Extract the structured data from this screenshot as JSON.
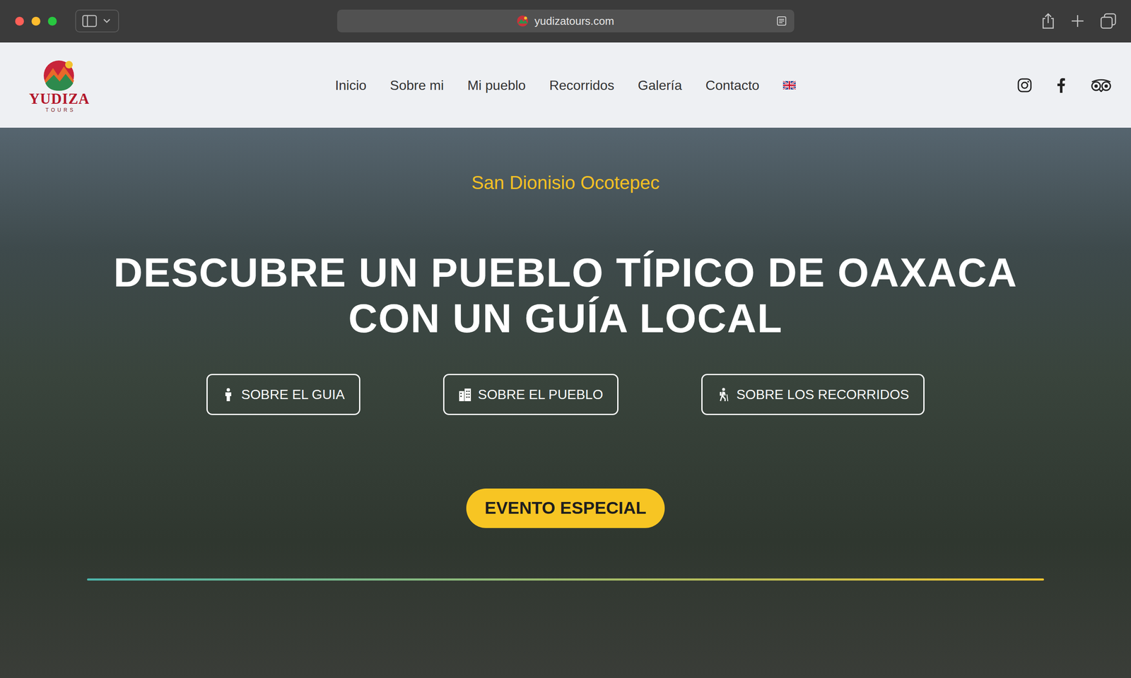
{
  "browser": {
    "url": "yudizatours.com"
  },
  "logo": {
    "name": "YUDIZA",
    "tagline": "TOURS"
  },
  "nav": {
    "links": [
      {
        "label": "Inicio",
        "selected": false
      },
      {
        "label": "Sobre mi",
        "selected": false
      },
      {
        "label": "Mi pueblo",
        "selected": false
      },
      {
        "label": "Recorridos",
        "selected": false
      },
      {
        "label": "Galería",
        "selected": false
      },
      {
        "label": "Contacto",
        "selected": false
      }
    ]
  },
  "hero": {
    "kicker": "San Dionisio Ocotepec",
    "heading_lines": [
      "DESCUBRE UN PUEBLO TÍPICO DE OAXACA",
      "CON UN GUÍA LOCAL"
    ],
    "buttons": [
      {
        "label": "SOBRE EL GUIA"
      },
      {
        "label": "SOBRE EL PUEBLO"
      },
      {
        "label": "SOBRE LOS RECORRIDOS"
      }
    ],
    "cta": "EVENTO ESPECIAL"
  }
}
